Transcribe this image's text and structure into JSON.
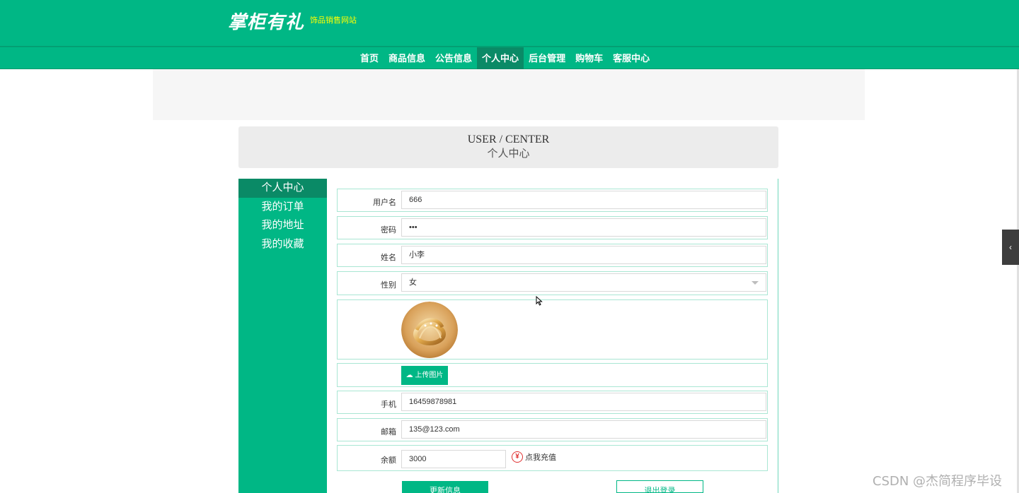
{
  "header": {
    "logo_text": "掌柜有礼",
    "subtitle": "饰品销售网站"
  },
  "nav": {
    "items": [
      "首页",
      "商品信息",
      "公告信息",
      "个人中心",
      "后台管理",
      "购物车",
      "客服中心"
    ],
    "active_index": 3
  },
  "title": {
    "en": "USER / CENTER",
    "cn": "个人中心"
  },
  "sidebar": {
    "items": [
      "个人中心",
      "我的订单",
      "我的地址",
      "我的收藏"
    ],
    "active_index": 0
  },
  "form": {
    "username_label": "用户名",
    "username_value": "666",
    "password_label": "密码",
    "password_value": "•••",
    "name_label": "姓名",
    "name_value": "小李",
    "gender_label": "性别",
    "gender_value": "女",
    "upload_label": "上传图片",
    "phone_label": "手机",
    "phone_value": "16459878981",
    "email_label": "邮箱",
    "email_value": "135@123.com",
    "balance_label": "余额",
    "balance_value": "3000",
    "recharge_icon": "¥",
    "recharge_label": "点我充值",
    "update_button": "更新信息",
    "logout_button": "退出登录"
  },
  "side_tab_icon": "‹",
  "watermark": "CSDN @杰简程序毕设",
  "colors": {
    "primary": "#00b785",
    "active": "#0a8a66",
    "recharge": "#e03030"
  }
}
